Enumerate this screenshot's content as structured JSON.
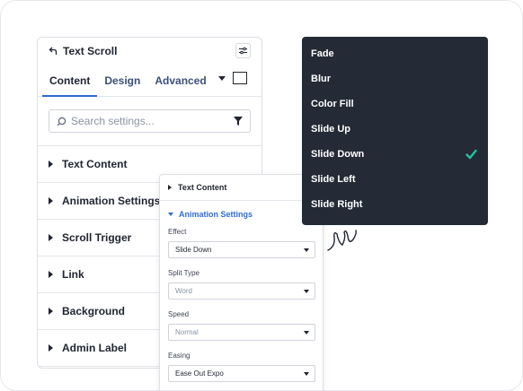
{
  "panel": {
    "title": "Text Scroll",
    "tabs": [
      "Content",
      "Design",
      "Advanced"
    ],
    "active_tab": "Content",
    "search": {
      "placeholder": "Search settings..."
    },
    "sections": [
      "Text Content",
      "Animation Settings",
      "Scroll Trigger",
      "Link",
      "Background",
      "Admin Label"
    ]
  },
  "subpanel": {
    "collapsed_section": "Text Content",
    "expanded_section": "Animation Settings",
    "fields": [
      {
        "label": "Effect",
        "value": "Slide Down",
        "is_placeholder": false
      },
      {
        "label": "Split Type",
        "value": "Word",
        "is_placeholder": true
      },
      {
        "label": "Speed",
        "value": "Normal",
        "is_placeholder": true
      },
      {
        "label": "Easing",
        "value": "Ease Out Expo",
        "is_placeholder": false
      }
    ]
  },
  "dropdown": {
    "options": [
      "Fade",
      "Blur",
      "Color Fill",
      "Slide Up",
      "Slide Down",
      "Slide Left",
      "Slide Right"
    ],
    "selected": "Slide Down"
  },
  "colors": {
    "accent": "#2f6bd8",
    "dropdown_bg": "#242b36",
    "check": "#1fc4a0"
  },
  "icons": [
    "back-arrow-icon",
    "settings-toggle-icon",
    "chevron-down-icon",
    "square-icon",
    "search-icon",
    "filter-icon",
    "caret-right-icon",
    "check-icon"
  ]
}
